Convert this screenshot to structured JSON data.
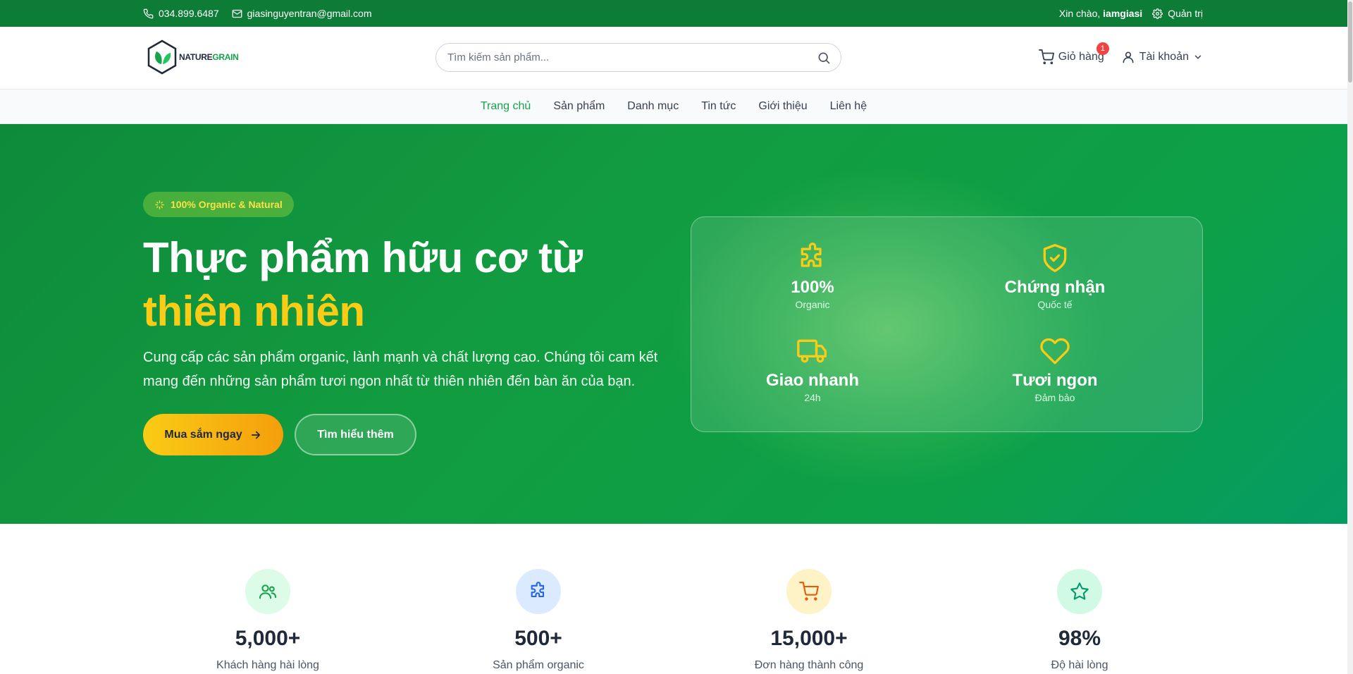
{
  "topbar": {
    "phone": "034.899.6487",
    "email": "giasinguyentran@gmail.com",
    "greeting_prefix": "Xin chào,",
    "username": "iamgiasi",
    "admin_label": "Quản trị"
  },
  "header": {
    "logo": {
      "part1": "NATURE",
      "part2": "GRAIN"
    },
    "search_placeholder": "Tìm kiếm sản phẩm...",
    "cart_label": "Giỏ hàng",
    "cart_count": "1",
    "account_label": "Tài khoản"
  },
  "nav": {
    "items": [
      {
        "label": "Trang chủ"
      },
      {
        "label": "Sản phẩm"
      },
      {
        "label": "Danh mục"
      },
      {
        "label": "Tin tức"
      },
      {
        "label": "Giới thiệu"
      },
      {
        "label": "Liên hệ"
      }
    ]
  },
  "hero": {
    "badge": "100% Organic & Natural",
    "title_line1": "Thực phẩm hữu cơ từ",
    "title_line2": "thiên nhiên",
    "subtitle": "Cung cấp các sản phẩm organic, lành mạnh và chất lượng cao. Chúng tôi cam kết mang đến những sản phẩm tươi ngon nhất từ thiên nhiên đến bàn ăn của bạn.",
    "primary_button": "Mua sắm ngay",
    "secondary_button": "Tìm hiểu thêm",
    "features": [
      {
        "title": "100%",
        "sub": "Organic",
        "icon": "puzzle-icon"
      },
      {
        "title": "Chứng nhận",
        "sub": "Quốc tế",
        "icon": "shield-check-icon"
      },
      {
        "title": "Giao nhanh",
        "sub": "24h",
        "icon": "truck-icon"
      },
      {
        "title": "Tươi ngon",
        "sub": "Đảm bảo",
        "icon": "heart-icon"
      }
    ]
  },
  "stats": [
    {
      "value": "5,000+",
      "label": "Khách hàng hài lòng",
      "icon": "users-icon",
      "color": "#16a34a",
      "bg": "#dcfce7"
    },
    {
      "value": "500+",
      "label": "Sản phẩm organic",
      "icon": "puzzle-icon",
      "color": "#2563eb",
      "bg": "#dbeafe"
    },
    {
      "value": "15,000+",
      "label": "Đơn hàng thành công",
      "icon": "cart-icon",
      "color": "#ea580c",
      "bg": "#fef3c7"
    },
    {
      "value": "98%",
      "label": "Độ hài lòng",
      "icon": "star-icon",
      "color": "#059669",
      "bg": "#d1fae5"
    }
  ],
  "colors": {
    "brand_green": "#0c7c36",
    "accent_yellow": "#facc15",
    "nav_active": "#16a34a"
  }
}
